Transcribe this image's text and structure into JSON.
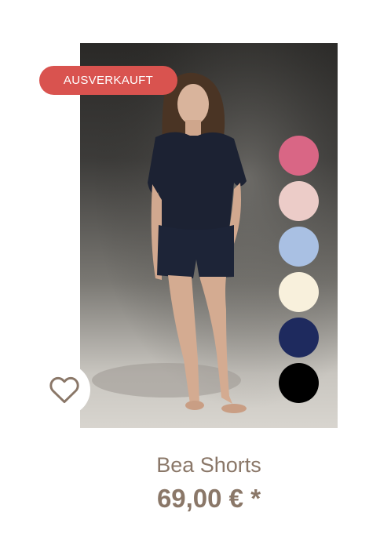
{
  "product": {
    "badge": "AUSVERKAUFT",
    "name": "Bea Shorts",
    "price": "69,00 € *",
    "image_alt": "Model in dark navy short sleeve top and Bea Shorts"
  },
  "swatches": [
    {
      "name": "pink",
      "color": "#d96685"
    },
    {
      "name": "rose",
      "color": "#ecccc8"
    },
    {
      "name": "light-blue",
      "color": "#a9c0e3"
    },
    {
      "name": "cream",
      "color": "#f8f0dc"
    },
    {
      "name": "navy",
      "color": "#1e2a5e"
    },
    {
      "name": "black",
      "color": "#000000"
    }
  ],
  "icons": {
    "wishlist": "heart-icon"
  },
  "colors": {
    "badge": "#d9534f",
    "text": "#8a7768"
  }
}
